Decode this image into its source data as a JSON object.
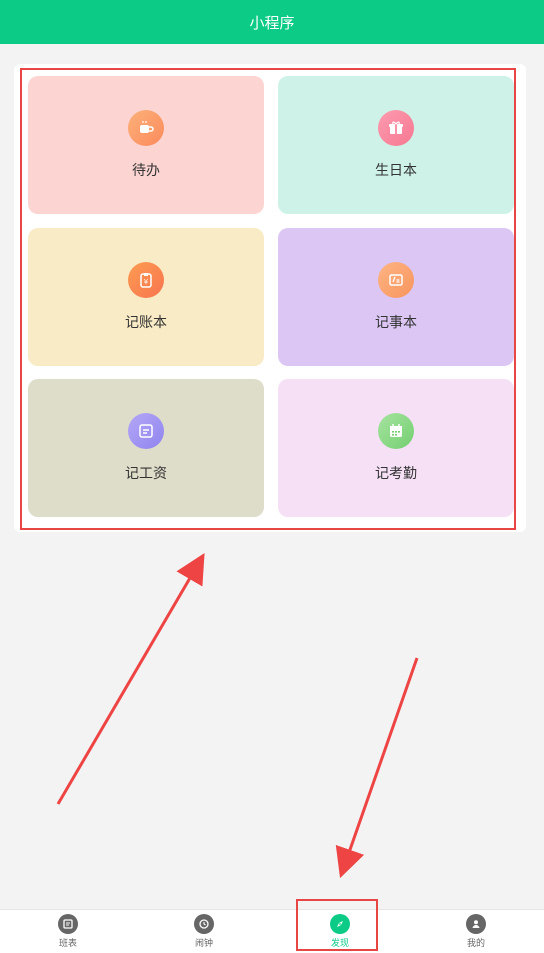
{
  "header": {
    "title": "小程序"
  },
  "tiles": [
    {
      "label": "待办",
      "icon": "coffee-cup-icon"
    },
    {
      "label": "生日本",
      "icon": "gift-icon"
    },
    {
      "label": "记账本",
      "icon": "money-bag-icon"
    },
    {
      "label": "记事本",
      "icon": "notepad-icon"
    },
    {
      "label": "记工资",
      "icon": "message-card-icon"
    },
    {
      "label": "记考勤",
      "icon": "calendar-icon"
    }
  ],
  "tabs": [
    {
      "label": "班表",
      "icon": "schedule-icon"
    },
    {
      "label": "闹钟",
      "icon": "clock-icon"
    },
    {
      "label": "发现",
      "icon": "compass-icon",
      "active": true
    },
    {
      "label": "我的",
      "icon": "user-icon"
    }
  ],
  "colors": {
    "brand": "#0ccb87",
    "highlight": "#e84545"
  }
}
